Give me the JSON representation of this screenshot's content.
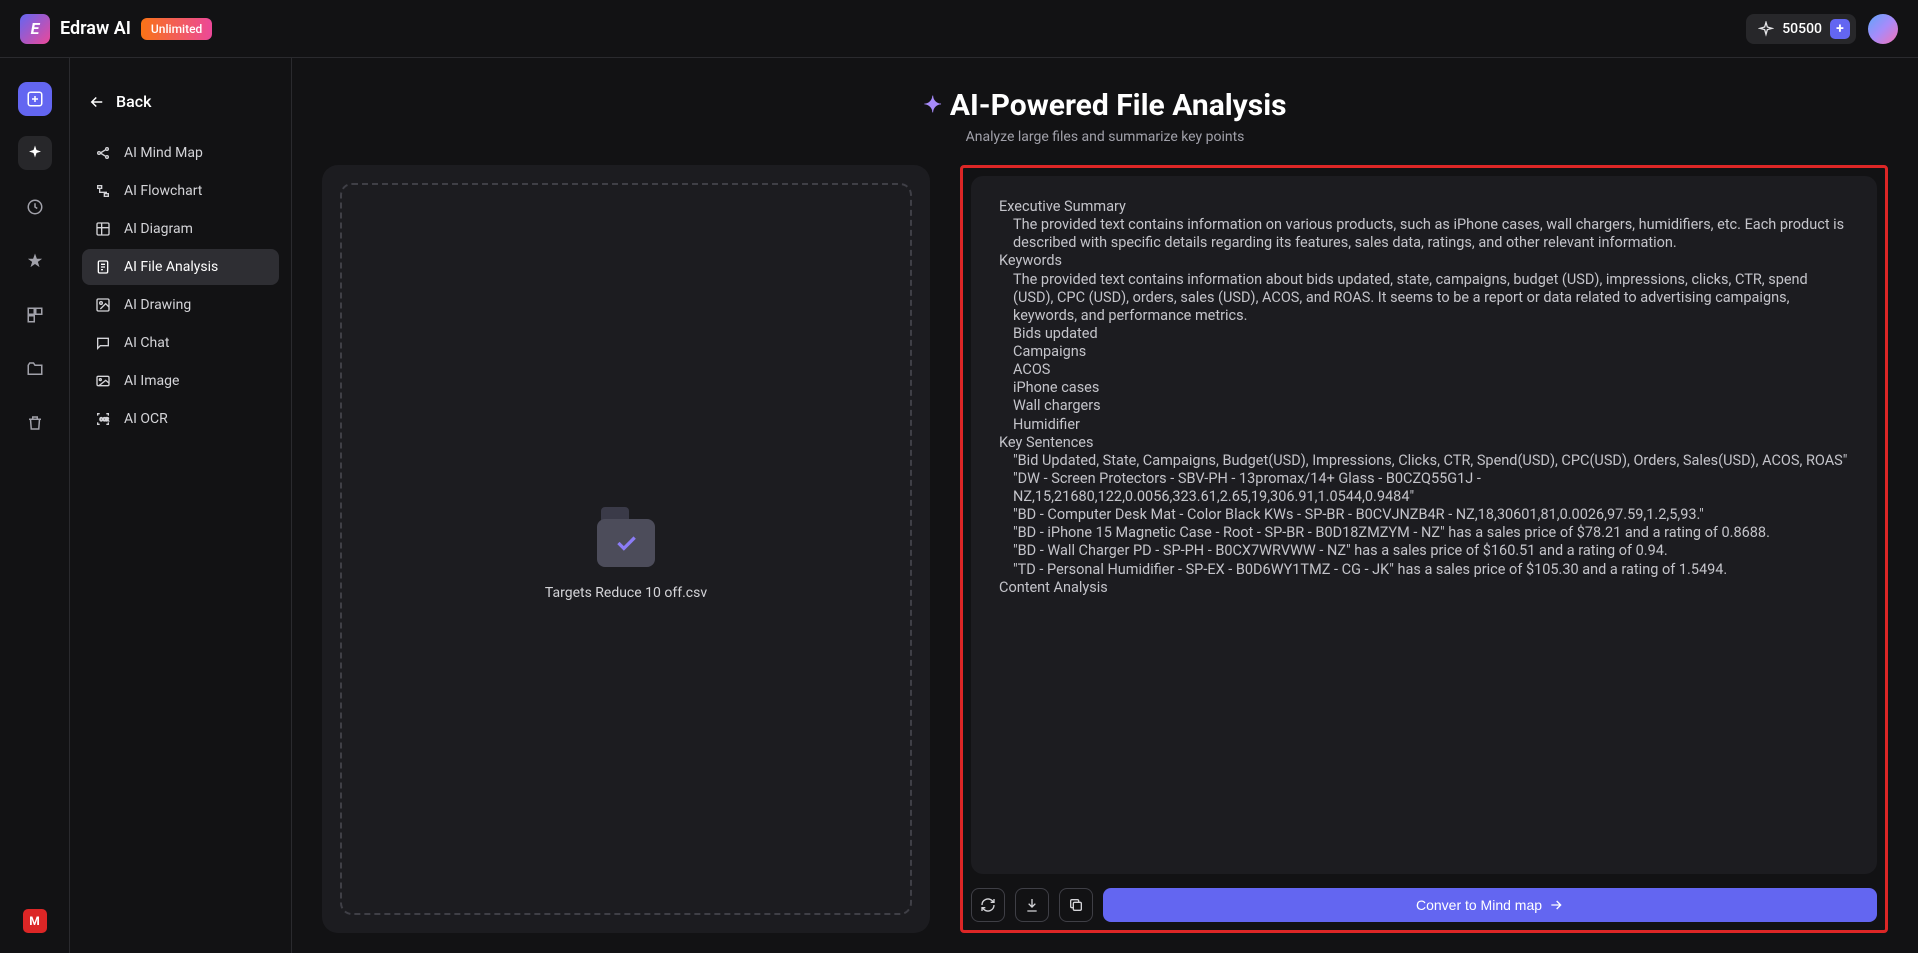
{
  "header": {
    "app_name": "Edraw AI",
    "badge": "Unlimited",
    "credits": "50500"
  },
  "sidebar": {
    "back": "Back",
    "items": [
      "AI Mind Map",
      "AI Flowchart",
      "AI Diagram",
      "AI File Analysis",
      "AI Drawing",
      "AI Chat",
      "AI Image",
      "AI OCR"
    ]
  },
  "main": {
    "title": "AI-Powered File Analysis",
    "subtitle": "Analyze large files and summarize key points",
    "dropzone_filename": "Targets Reduce 10 off.csv",
    "convert_label": "Conver to Mind map"
  },
  "result": {
    "h_exec": "Executive Summary",
    "p_exec": "The provided text contains information on various products, such as iPhone cases, wall chargers, humidifiers, etc. Each product is described with specific details regarding its features, sales data, ratings, and other relevant information.",
    "h_keywords": "Keywords",
    "p_keywords": "The provided text contains information about bids updated, state, campaigns, budget (USD), impressions, clicks, CTR, spend (USD), CPC (USD), orders, sales (USD), ACOS, and ROAS. It seems to be a report or data related to advertising campaigns, keywords, and performance metrics.",
    "kw": [
      "Bids updated",
      "Campaigns",
      "ACOS",
      "iPhone cases",
      "Wall chargers",
      "Humidifier"
    ],
    "h_keysent": "Key Sentences",
    "ks": [
      "\"Bid Updated, State, Campaigns, Budget(USD), Impressions, Clicks, CTR, Spend(USD), CPC(USD), Orders, Sales(USD), ACOS, ROAS\"",
      "\"DW - Screen Protectors - SBV-PH - 13promax/14+ Glass - B0CZQ55G1J - NZ,15,21680,122,0.0056,323.61,2.65,19,306.91,1.0544,0.9484\"",
      "\"BD - Computer Desk Mat - Color Black KWs - SP-BR - B0CVJNZB4R - NZ,18,30601,81,0.0026,97.59,1.2,5,93.\"",
      "\"BD - iPhone 15 Magnetic Case - Root - SP-BR - B0D18ZMZYM - NZ\" has a sales price of $78.21 and a rating of 0.8688.",
      "\"BD - Wall Charger PD - SP-PH - B0CX7WRVWW - NZ\" has a sales price of $160.51 and a rating of 0.94.",
      "\"TD - Personal Humidifier - SP-EX - B0D6WY1TMZ - CG - JK\" has a sales price of $105.30 and a rating of 1.5494."
    ],
    "h_content": "Content Analysis"
  },
  "rail_badge": "M"
}
